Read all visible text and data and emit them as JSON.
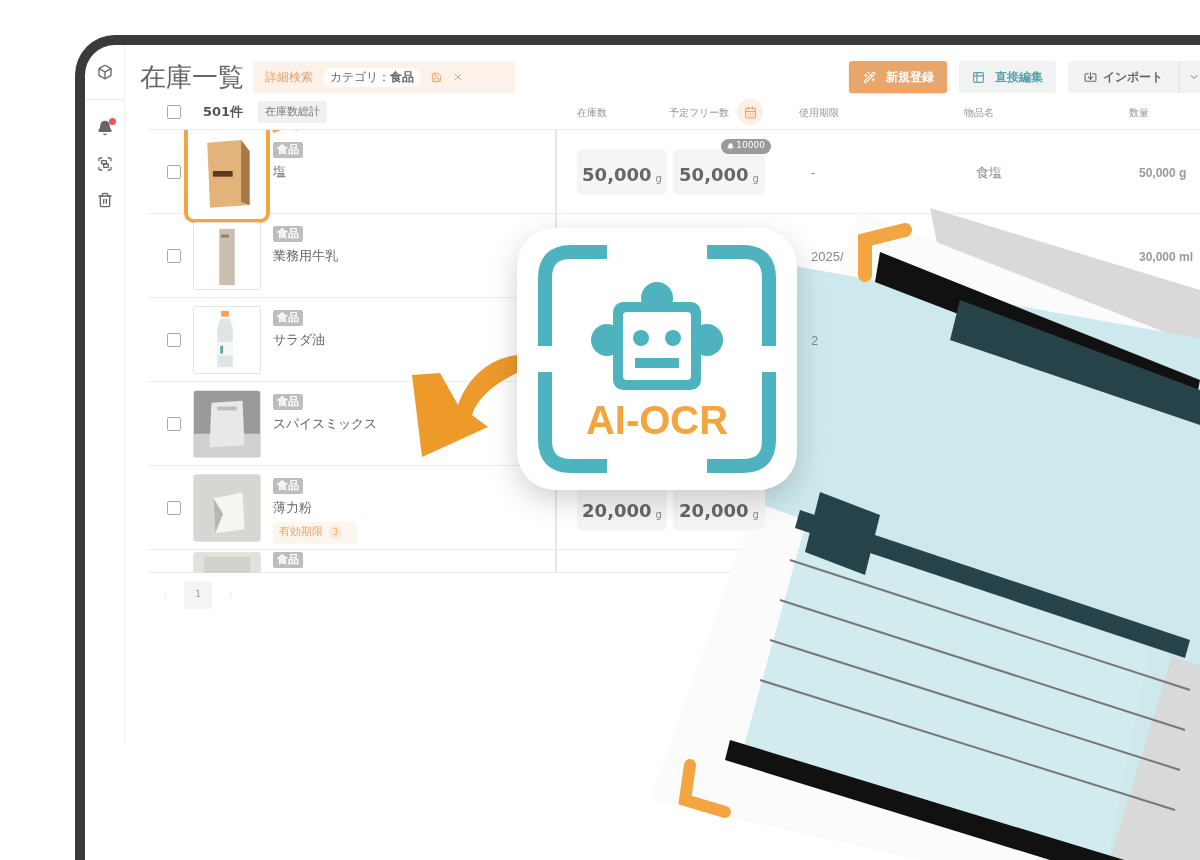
{
  "sidebar": {
    "has_alert": true
  },
  "page": {
    "title": "在庫一覧"
  },
  "filter": {
    "label": "詳細検索",
    "chip": "カテゴリ：**食品**"
  },
  "actions": [
    {
      "kind": "primary",
      "label": "新規登録"
    },
    {
      "kind": "secondary",
      "label": "直接編集"
    },
    {
      "kind": "import",
      "label": "インポート"
    }
  ],
  "summary": {
    "checked": false,
    "count": "501件",
    "total_label": "在庫数総計"
  },
  "columns": [
    "在庫数",
    "予定フリー数",
    "使用期限",
    "物品名",
    "数量"
  ],
  "rows": [
    {
      "checked": false,
      "highlighted": true,
      "tag": "食品",
      "name": "塩",
      "stock": "50,000",
      "stock_unit": "g",
      "free": "50,000",
      "free_unit": "g",
      "alert": "10000",
      "expiry": "-",
      "item_name": "食塩",
      "quantity": "50,000 g"
    },
    {
      "checked": false,
      "highlighted": false,
      "tag": "食品",
      "name": "業務用牛乳",
      "expiry": "2025/",
      "quantity": "30,000 ml"
    },
    {
      "checked": false,
      "highlighted": false,
      "tag": "食品",
      "name": "サラダ油",
      "expiry": "2"
    },
    {
      "checked": false,
      "highlighted": false,
      "tag": "食品",
      "name": "スパイスミックス"
    },
    {
      "checked": false,
      "highlighted": false,
      "tag": "食品",
      "name": "薄力粉",
      "expiry_tag": "有効期限",
      "expiry_count": "3",
      "stock": "20,000",
      "stock_unit": "g",
      "free": "20,000",
      "free_unit": "g"
    },
    {
      "highlighted": false,
      "tag": "食品",
      "partial": true
    }
  ],
  "pagination": {
    "pages": [
      {
        "label": "1",
        "selected": true
      }
    ]
  },
  "overlay": {
    "badge_label": "AI-OCR"
  }
}
